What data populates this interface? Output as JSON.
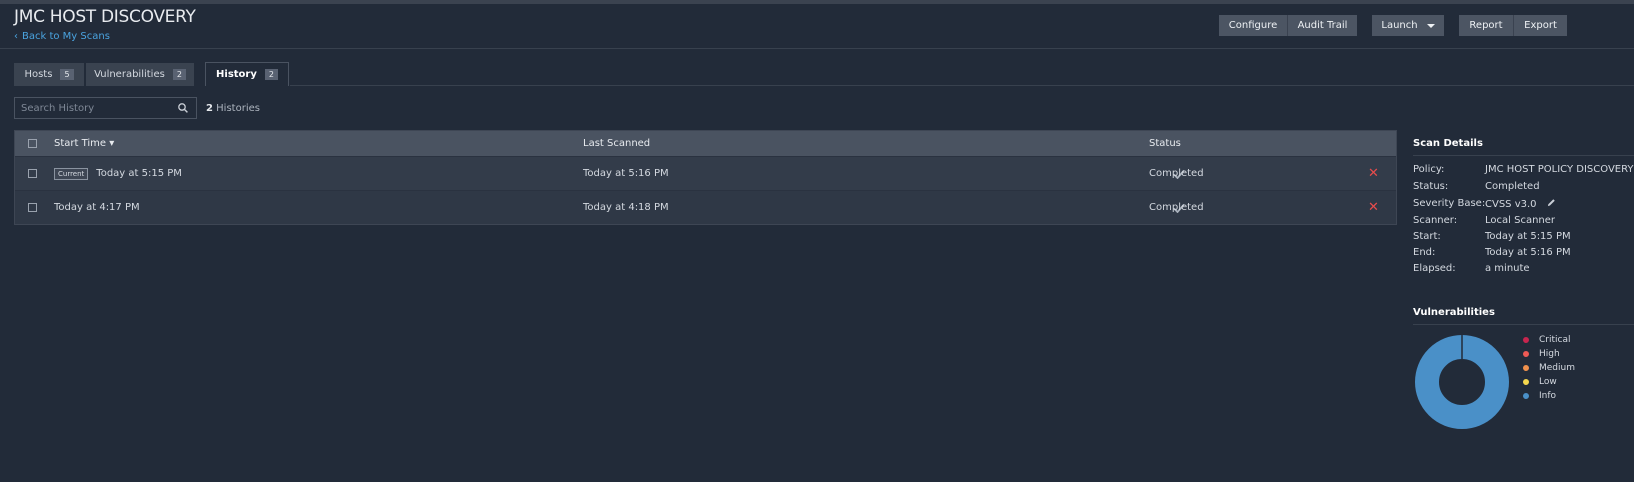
{
  "header": {
    "title": "JMC HOST DISCOVERY",
    "back_label": "Back to My Scans",
    "buttons": {
      "configure": "Configure",
      "audit_trail": "Audit Trail",
      "launch": "Launch",
      "report": "Report",
      "export": "Export"
    }
  },
  "tabs": [
    {
      "label": "Hosts",
      "count": "5"
    },
    {
      "label": "Vulnerabilities",
      "count": "2"
    },
    {
      "label": "History",
      "count": "2",
      "active": true
    }
  ],
  "search": {
    "placeholder": "Search History"
  },
  "histories": {
    "count": "2",
    "label": "Histories"
  },
  "table": {
    "columns": {
      "start_time": "Start Time",
      "last_scanned": "Last Scanned",
      "status": "Status"
    },
    "sort_indicator": "▾",
    "rows": [
      {
        "tag": "Current",
        "start": "Today at 5:15 PM",
        "last": "Today at 5:16 PM",
        "status": "Completed"
      },
      {
        "tag": "",
        "start": "Today at 4:17 PM",
        "last": "Today at 4:18 PM",
        "status": "Completed"
      }
    ]
  },
  "scan_details": {
    "title": "Scan Details",
    "items": [
      {
        "k": "Policy:",
        "v": "JMC HOST POLICY DISCOVERY"
      },
      {
        "k": "Status:",
        "v": "Completed"
      },
      {
        "k": "Severity Base:",
        "v": "CVSS v3.0"
      },
      {
        "k": "Scanner:",
        "v": "Local Scanner"
      },
      {
        "k": "Start:",
        "v": "Today at 5:15 PM"
      },
      {
        "k": "End:",
        "v": "Today at 5:16 PM"
      },
      {
        "k": "Elapsed:",
        "v": "a minute"
      }
    ]
  },
  "vulnerabilities": {
    "title": "Vulnerabilities",
    "legend": [
      {
        "label": "Critical",
        "color": "#c7254e"
      },
      {
        "label": "High",
        "color": "#ee5a55"
      },
      {
        "label": "Medium",
        "color": "#f0914d"
      },
      {
        "label": "Low",
        "color": "#f5d74e"
      },
      {
        "label": "Info",
        "color": "#4a90c8"
      }
    ]
  },
  "colors": {
    "accent": "#4aa3df",
    "delete": "#e74c4c",
    "info": "#4a90c8"
  }
}
